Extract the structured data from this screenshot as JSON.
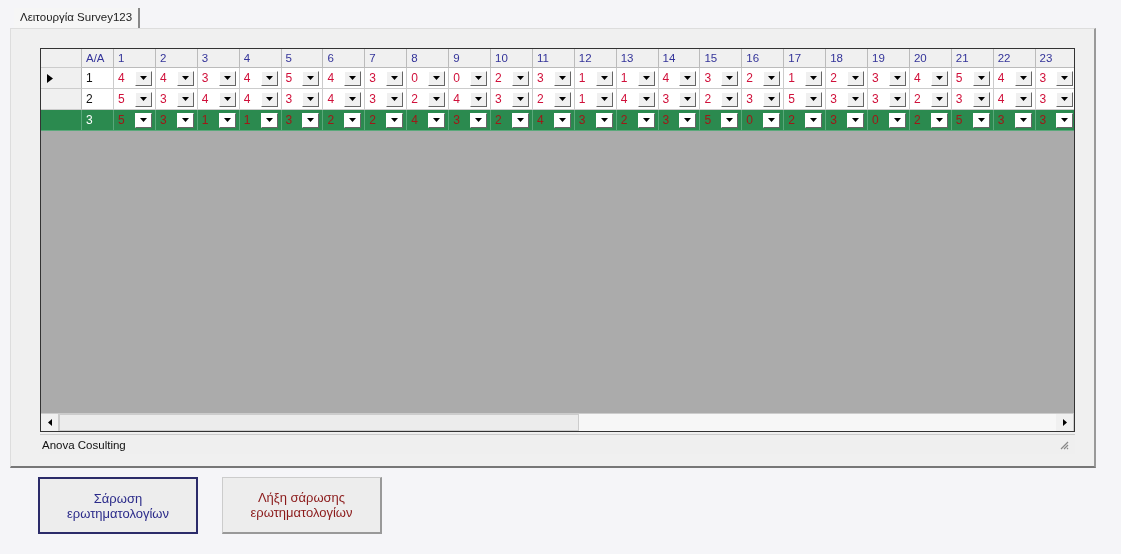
{
  "tab": {
    "label": "Λειτουργία Survey123",
    "selected": true
  },
  "table": {
    "columns": [
      "A/A",
      "1",
      "2",
      "3",
      "4",
      "5",
      "6",
      "7",
      "8",
      "9",
      "10",
      "11",
      "12",
      "13",
      "14",
      "15",
      "16",
      "17",
      "18",
      "19",
      "20",
      "21",
      "22",
      "23"
    ],
    "rows": [
      {
        "current": true,
        "selected": false,
        "cells": [
          "1",
          "4",
          "4",
          "3",
          "4",
          "5",
          "4",
          "3",
          "0",
          "0",
          "2",
          "3",
          "1",
          "1",
          "4",
          "3",
          "2",
          "1",
          "2",
          "3",
          "4",
          "5",
          "4",
          "3"
        ]
      },
      {
        "current": false,
        "selected": false,
        "cells": [
          "2",
          "5",
          "3",
          "4",
          "4",
          "3",
          "4",
          "3",
          "2",
          "4",
          "3",
          "2",
          "1",
          "4",
          "3",
          "2",
          "3",
          "5",
          "3",
          "3",
          "2",
          "3",
          "4",
          "3"
        ]
      },
      {
        "current": false,
        "selected": true,
        "cells": [
          "3",
          "5",
          "3",
          "1",
          "1",
          "3",
          "2",
          "2",
          "4",
          "3",
          "2",
          "4",
          "3",
          "2",
          "3",
          "5",
          "0",
          "2",
          "3",
          "0",
          "2",
          "5",
          "3",
          "3"
        ]
      }
    ]
  },
  "status_bar": "Anova Cosulting",
  "buttons": [
    {
      "label": "Σάρωση\nερωτηματολογίων",
      "focused": true,
      "color": "#2b2b8a"
    },
    {
      "label": "Λήξη σάρωσης\nερωτηματολογίων",
      "focused": false,
      "color": "#8b1a1a"
    }
  ]
}
